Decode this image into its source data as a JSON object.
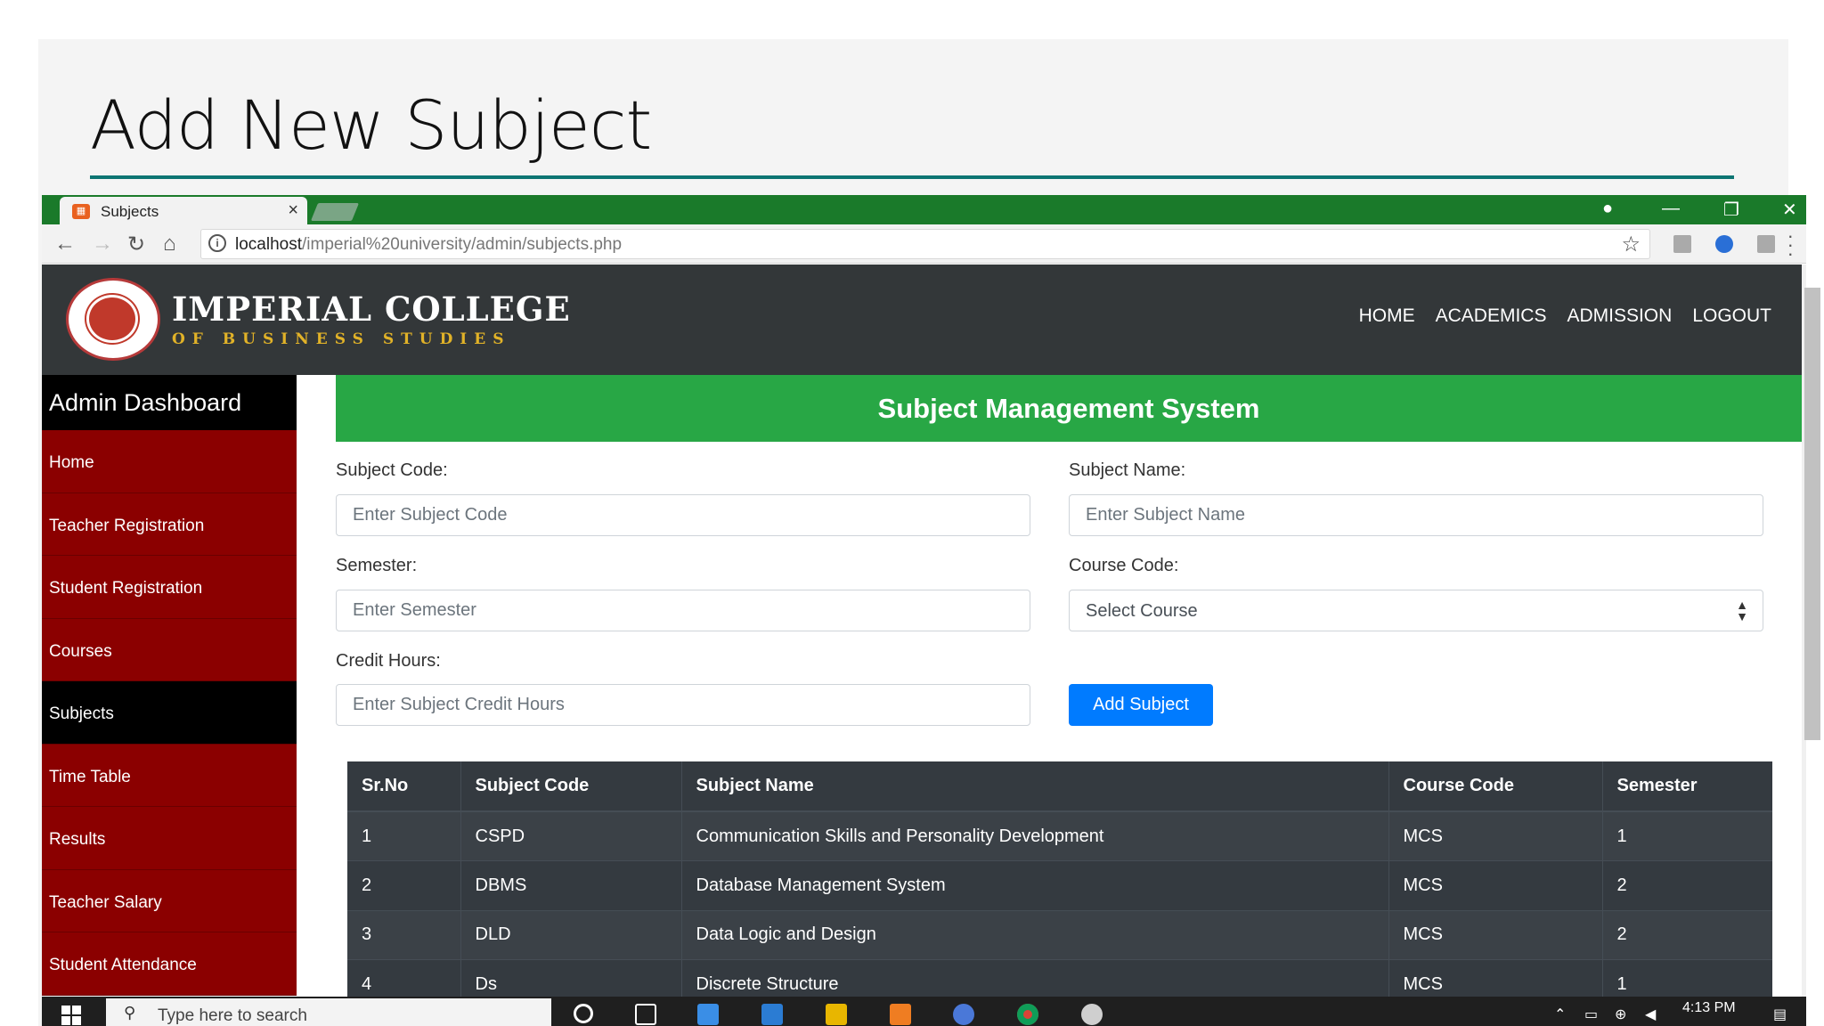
{
  "slide": {
    "title": "Add New Subject"
  },
  "browser": {
    "tab_title": "Subjects",
    "tab_close": "×",
    "url_host": "localhost",
    "url_path": "/imperial%20university/admin/subjects.php"
  },
  "site": {
    "brand_line1": "IMPERIAL COLLEGE",
    "brand_line2": "OF BUSINESS STUDIES",
    "nav": [
      "HOME",
      "ACADEMICS",
      "ADMISSION",
      "LOGOUT"
    ]
  },
  "sidebar": {
    "title": "Admin Dashboard",
    "items": [
      "Home",
      "Teacher Registration",
      "Student Registration",
      "Courses",
      "Subjects",
      "Time Table",
      "Results",
      "Teacher Salary",
      "Student Attendance"
    ],
    "active": "Subjects"
  },
  "main": {
    "heading": "Subject Management System",
    "subject_code_label": "Subject Code:",
    "subject_code_placeholder": "Enter Subject Code",
    "subject_name_label": "Subject Name:",
    "subject_name_placeholder": "Enter Subject Name",
    "semester_label": "Semester:",
    "semester_placeholder": "Enter Semester",
    "course_code_label": "Course Code:",
    "course_code_selected": "Select Course",
    "credit_hours_label": "Credit Hours:",
    "credit_hours_placeholder": "Enter Subject Credit Hours",
    "add_button": "Add Subject"
  },
  "table": {
    "headers": [
      "Sr.No",
      "Subject Code",
      "Subject Name",
      "Course Code",
      "Semester"
    ],
    "rows": [
      [
        "1",
        "CSPD",
        "Communication Skills and Personality Development",
        "MCS",
        "1"
      ],
      [
        "2",
        "DBMS",
        "Database Management System",
        "MCS",
        "2"
      ],
      [
        "3",
        "DLD",
        "Data Logic and Design",
        "MCS",
        "2"
      ],
      [
        "4",
        "Ds",
        "Discrete Structure",
        "MCS",
        "1"
      ]
    ]
  },
  "taskbar": {
    "search_placeholder": "Type here to search",
    "time": "4:13 PM"
  },
  "colors": {
    "tabbar": "#1a7a2a",
    "header_dark": "#333739",
    "sidebar_red": "#8b0000",
    "success_green": "#28a745",
    "primary_blue": "#007bff",
    "brand_gold": "#e1b228",
    "table_dark": "#343a40",
    "slide_rule": "#0d7572"
  },
  "icons": [
    "back-arrow-icon",
    "forward-arrow-icon",
    "reload-icon",
    "home-icon",
    "info-icon",
    "star-icon",
    "close-icon",
    "minimize-icon",
    "maximize-icon",
    "profile-icon",
    "chevron-up-down-icon",
    "search-icon",
    "windows-icon"
  ]
}
